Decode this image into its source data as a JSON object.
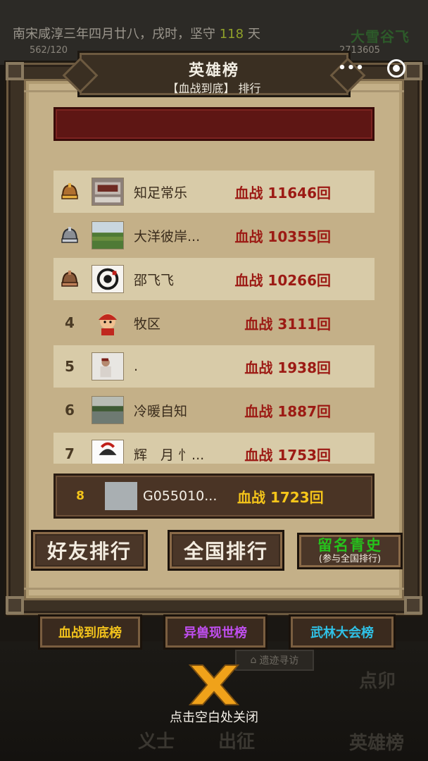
{
  "background": {
    "status_text_prefix": "南宋咸淳三年四月廿八，戌时，坚守",
    "status_days": "118",
    "status_text_suffix": "天",
    "hp": "562/120",
    "coins": "2713605",
    "title_right": "大雪谷飞",
    "words": [
      "义士",
      "出征",
      "英雄榜",
      "点卯"
    ],
    "small_btn": "遗迹寻访"
  },
  "panel": {
    "title": "英雄榜",
    "subtitle": "【血战到底】 排行",
    "more_icon": "more-dots-icon",
    "close_icon": "target-circle-icon"
  },
  "list": {
    "rows": [
      {
        "rank": "",
        "rank_icon": "gold-helmet-icon",
        "name": "知足常乐",
        "score": "血战 11646回",
        "avatar": "banner-photo"
      },
      {
        "rank": "",
        "rank_icon": "silver-helmet-icon",
        "name": "大洋彼岸...",
        "score": "血战 10355回",
        "avatar": "landscape-photo"
      },
      {
        "rank": "",
        "rank_icon": "bronze-helmet-icon",
        "name": "邵飞飞",
        "score": "血战 10266回",
        "avatar": "ink-logo"
      },
      {
        "rank": "4",
        "name": "牧区",
        "score": "血战 3111回",
        "avatar": "warrior-cartoon"
      },
      {
        "rank": "5",
        "name": ".",
        "score": "血战 1938回",
        "avatar": "portrait-photo"
      },
      {
        "rank": "6",
        "name": "冷暖自知",
        "score": "血战 1887回",
        "avatar": "lake-photo"
      },
      {
        "rank": "7",
        "name": "辉　月 忄...",
        "score": "血战 1753回",
        "avatar": "helmet-cartoon"
      }
    ]
  },
  "me": {
    "rank": "8",
    "name": "G055010...",
    "score": "血战 1723回"
  },
  "buttons": {
    "friends": "好友排行",
    "national": "全国排行",
    "fame_main": "留名青史",
    "fame_sub": "(参与全国排行)"
  },
  "tabs": [
    {
      "label": "血战到底榜",
      "color": "#f2c21c"
    },
    {
      "label": "异兽现世榜",
      "color": "#c04ef0"
    },
    {
      "label": "武林大会榜",
      "color": "#2fc1e6"
    }
  ],
  "close_hint": "点击空白处关闭",
  "colors": {
    "score_red": "#9c1a14",
    "gold": "#f5c51a",
    "fame_green": "#26c21c",
    "close_x": "#f0a21a"
  }
}
